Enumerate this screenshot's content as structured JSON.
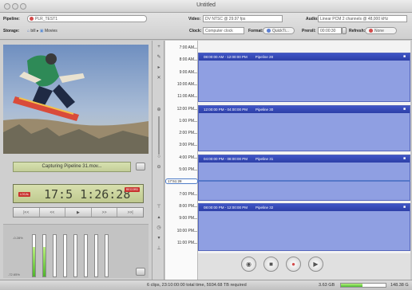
{
  "window": {
    "title": "Untitled"
  },
  "toolbar": {
    "pipeline_label": "Pipeline:",
    "pipeline_value": "PLR_TEST1",
    "storage_label": "Storage:",
    "storage_path": [
      "bill",
      "Movies"
    ],
    "video_label": "Video:",
    "video_value": "DV NTSC @ 29.97 fps",
    "audio_label": "Audio:",
    "audio_value": "Linear PCM 2 channels @ 48,000 kHz",
    "clock_label": "Clock:",
    "clock_value": "Computer clock",
    "format_label": "Format:",
    "format_value": "QuickTi...",
    "preroll_label": "Preroll:",
    "preroll_value": "00:00:30",
    "refresh_label": "Refresh:",
    "refresh_value": "None"
  },
  "capture": {
    "status": "Capturing Pipeline 31.mov...",
    "timecode": "17:5 1:26:28",
    "left_tag": "LOCAL",
    "right_tag": "RECORD",
    "transport": [
      "|<<",
      "<<",
      "▶",
      ">>",
      ">>|"
    ]
  },
  "meters": {
    "top_label": "-0.28%",
    "bottom_label": "-72.65%",
    "levels": [
      0.72,
      0.72,
      0,
      0,
      0,
      0,
      0,
      0
    ]
  },
  "ruler": {
    "times": [
      "7:00 AM",
      "8:00 AM",
      "9:00 AM",
      "10:00 AM",
      "11:00 AM",
      "12:00 PM",
      "1:00 PM",
      "2:00 PM",
      "3:00 PM",
      "4:00 PM",
      "5:00 PM",
      "",
      "7:00 PM",
      "8:00 PM",
      "9:00 PM",
      "10:00 PM",
      "11:00 PM"
    ],
    "now": "17:51:28"
  },
  "schedule": [
    {
      "label": "08:00:00 AM - 12:00:00 PM",
      "name": "Pipeline 28"
    },
    {
      "label": "12:00:00 PM - 04:00:00 PM",
      "name": "Pipeline 30"
    },
    {
      "label": "04:00:00 PM - 08:00:00 PM",
      "name": "Pipeline 31"
    },
    {
      "label": "08:00:00 PM - 12:00:00 PM",
      "name": "Pipeline 32"
    }
  ],
  "statusbar": {
    "summary": "6 clips, 23:10:00:00 total time, 5934.68 TB required",
    "disk_used": "3.63 GB",
    "disk_fraction": 0.48,
    "disk_total": "148.38 G"
  }
}
